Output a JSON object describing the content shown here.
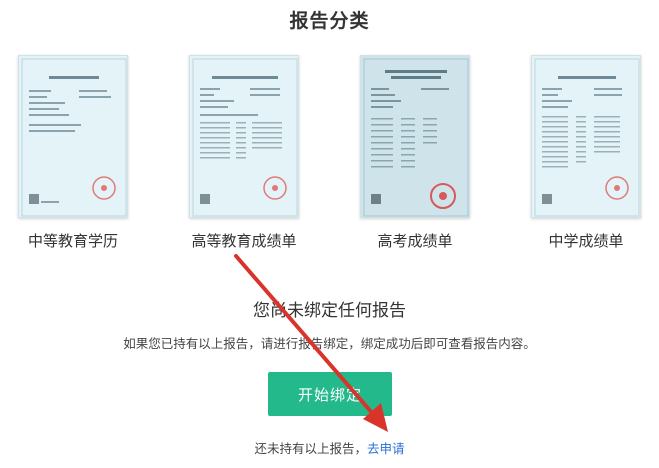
{
  "page": {
    "title": "报告分类",
    "headline": "您尚未绑定任何报告",
    "description": "如果您已持有以上报告，请进行报告绑定，绑定成功后即可查看报告内容。",
    "bind_button_label": "开始绑定",
    "apply_prompt": "还未持有以上报告，",
    "apply_link_label": "去申请"
  },
  "report_types": [
    {
      "label": "中等教育学历"
    },
    {
      "label": "高等教育成绩单"
    },
    {
      "label": "高考成绩单"
    },
    {
      "label": "中学成绩单"
    }
  ],
  "colors": {
    "accent_green": "#23b98a",
    "link_blue": "#2b6fd6",
    "annotation_red": "#d9342b",
    "card_bg": "#e4f3f7"
  },
  "icons": {
    "annotation": "red-arrow-icon",
    "stamp": "red-seal-stamp-icon"
  }
}
